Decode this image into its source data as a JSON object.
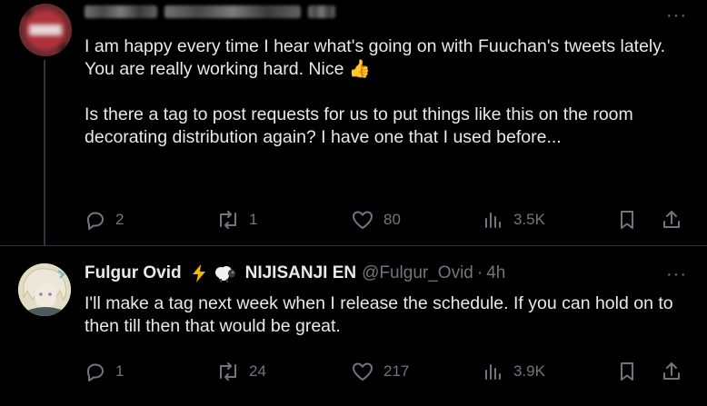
{
  "tweets": [
    {
      "author": {
        "display_name": "",
        "handle": "",
        "badges": []
      },
      "text": [
        "I am happy every time I hear what's going on with Fuuchan's tweets lately. You are really working hard. Nice 👍",
        "Is there a tag to post requests for us to put things like this on the room decorating distribution again? I have one that I used before..."
      ],
      "more_label": "···",
      "actions": {
        "replies": "2",
        "reposts": "1",
        "likes": "80",
        "views": "3.5K"
      }
    },
    {
      "author": {
        "display_name": "Fulgur Ovid",
        "affiliation": "NIJISANJI EN",
        "handle": "@Fulgur_Ovid",
        "separator": "·",
        "time": "4h"
      },
      "text": [
        "I'll make a tag next week when I release the schedule. If you can hold on to then till then that would be great."
      ],
      "more_label": "···",
      "actions": {
        "replies": "1",
        "reposts": "24",
        "likes": "217",
        "views": "3.9K"
      }
    }
  ],
  "icons": {
    "reply": "reply-icon",
    "repost": "repost-icon",
    "like": "heart-icon",
    "views": "views-icon",
    "bookmark": "bookmark-icon",
    "share": "share-icon",
    "lightning": "lightning-emoji-icon",
    "sheep": "sheep-emoji-icon",
    "thumbs_up": "thumbs-up-emoji-icon"
  },
  "colors": {
    "background": "#000000",
    "text": "#e7e9ea",
    "muted": "#71767b",
    "divider": "#2f3336",
    "lightning": "#f7b500"
  }
}
